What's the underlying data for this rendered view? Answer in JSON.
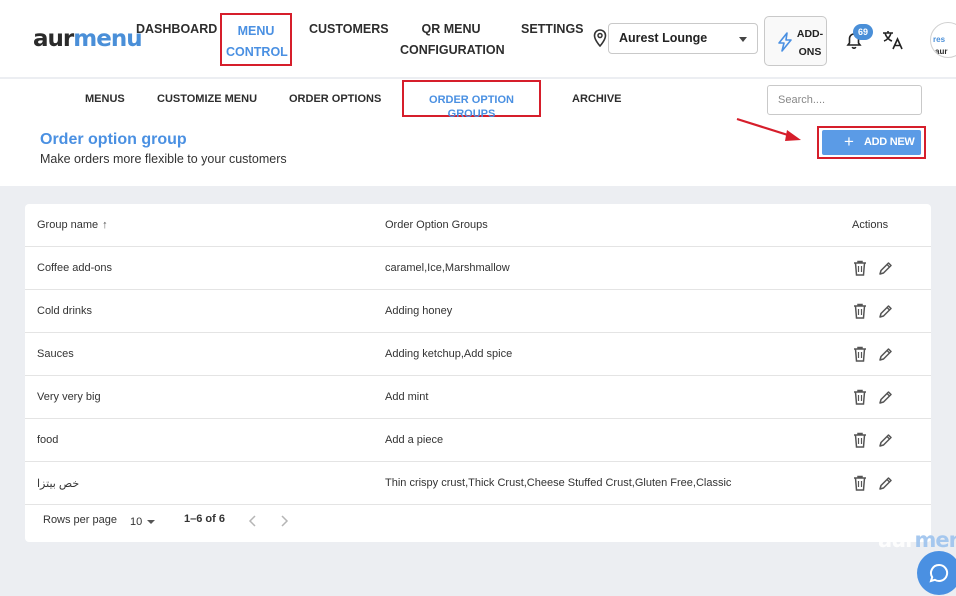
{
  "brand": {
    "logo_left": "aur",
    "logo_right": "menu",
    "avatar_text_left": "aur",
    "avatar_text_right": "res"
  },
  "nav": [
    {
      "label": "DASHBOARD"
    },
    {
      "label": "MENU CONTROL"
    },
    {
      "label": "CUSTOMERS"
    },
    {
      "label": "QR MENU CONFIGURATION"
    },
    {
      "label": "SETTINGS"
    }
  ],
  "location": {
    "selected": "Aurest Lounge"
  },
  "addons": {
    "label": "ADD-ONS"
  },
  "notifications": {
    "count": "69"
  },
  "subnav": [
    {
      "label": "MENUS"
    },
    {
      "label": "CUSTOMIZE MENU"
    },
    {
      "label": "ORDER OPTIONS"
    },
    {
      "label": "ORDER OPTION GROUPS"
    },
    {
      "label": "ARCHIVE"
    }
  ],
  "search": {
    "placeholder": "Search...."
  },
  "page": {
    "title": "Order option group",
    "subtitle": "Make orders more flexible to your customers",
    "add_new": "ADD NEW"
  },
  "table": {
    "headers": {
      "name": "Group name",
      "groups": "Order Option Groups",
      "actions": "Actions"
    },
    "rows": [
      {
        "name": "Coffee add-ons",
        "groups": "caramel,Ice,Marshmallow"
      },
      {
        "name": "Cold drinks",
        "groups": "Adding honey"
      },
      {
        "name": "Sauces",
        "groups": "Adding ketchup,Add spice"
      },
      {
        "name": "Very very big",
        "groups": "Add mint"
      },
      {
        "name": "food",
        "groups": "Add a piece"
      },
      {
        "name": "خص بيتزا",
        "groups": "Thin crispy crust,Thick Crust,Cheese Stuffed Crust,Gluten Free,Classic"
      }
    ]
  },
  "pagination": {
    "rows_per_page_label": "Rows per page",
    "rows_per_page": "10",
    "range": "1–6 of 6"
  },
  "watermark": {
    "left": "aur",
    "right": "menu"
  },
  "colors": {
    "accent": "#4a90e2",
    "highlight": "#d61e2b",
    "button": "#5b9be6"
  }
}
